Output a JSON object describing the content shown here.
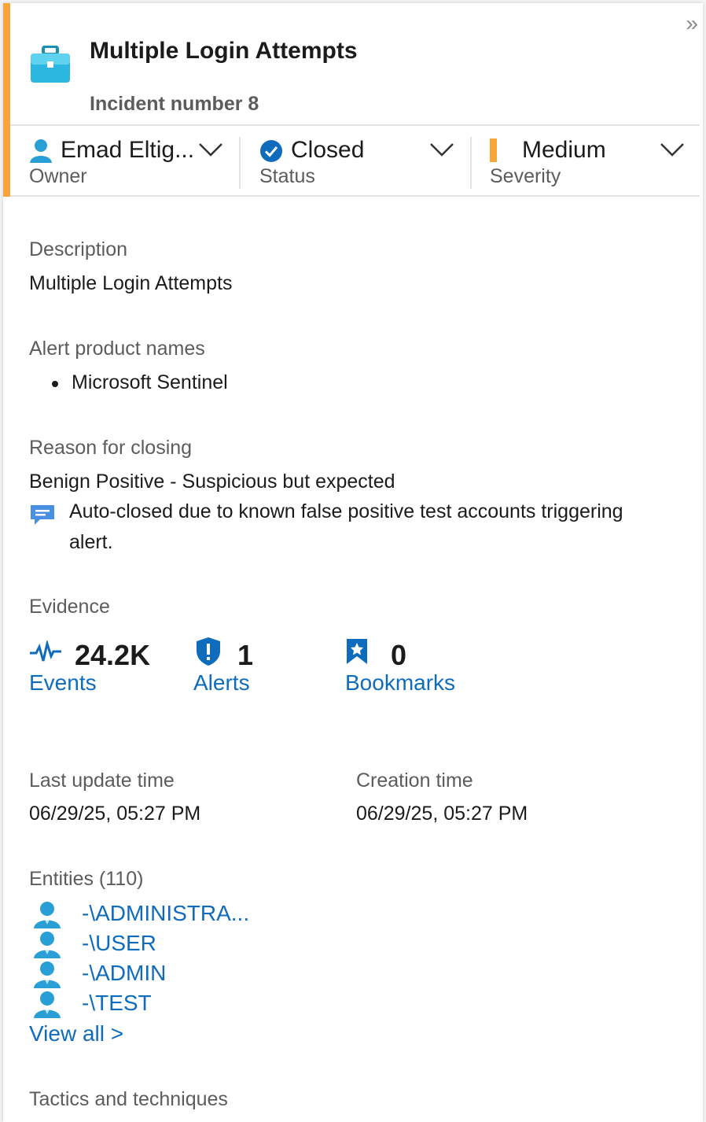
{
  "header": {
    "title": "Multiple Login Attempts",
    "incident_number": "Incident number 8",
    "collapse_glyph": "»"
  },
  "meta": {
    "owner": {
      "value": "Emad Eltig...",
      "label": "Owner"
    },
    "status": {
      "value": "Closed",
      "label": "Status"
    },
    "severity": {
      "value": "Medium",
      "label": "Severity",
      "color": "#f7a538"
    }
  },
  "description": {
    "label": "Description",
    "text": "Multiple Login Attempts"
  },
  "alert_products": {
    "label": "Alert product names",
    "items": [
      "Microsoft Sentinel"
    ]
  },
  "closing": {
    "label": "Reason for closing",
    "reason": "Benign Positive - Suspicious but expected",
    "comment_line1": "Auto-closed due to known false positive test accounts triggering",
    "comment_line2": "alert."
  },
  "evidence": {
    "label": "Evidence",
    "events": {
      "count": "24.2K",
      "link": "Events"
    },
    "alerts": {
      "count": "1",
      "link": "Alerts"
    },
    "bookmarks": {
      "count": "0",
      "link": "Bookmarks"
    }
  },
  "times": {
    "last_update_label": "Last update time",
    "last_update_value": "06/29/25, 05:27 PM",
    "creation_label": "Creation time",
    "creation_value": "06/29/25, 05:27 PM"
  },
  "entities": {
    "label": "Entities (110)",
    "items": [
      "-\\ADMINISTRA...",
      "-\\USER",
      "-\\ADMIN",
      "-\\TEST"
    ],
    "view_all": "View all >"
  },
  "tactics": {
    "label": "Tactics and techniques"
  },
  "colors": {
    "accent": "#f7a538",
    "link": "#0f6cbd",
    "status_check": "#0f6cbd"
  }
}
